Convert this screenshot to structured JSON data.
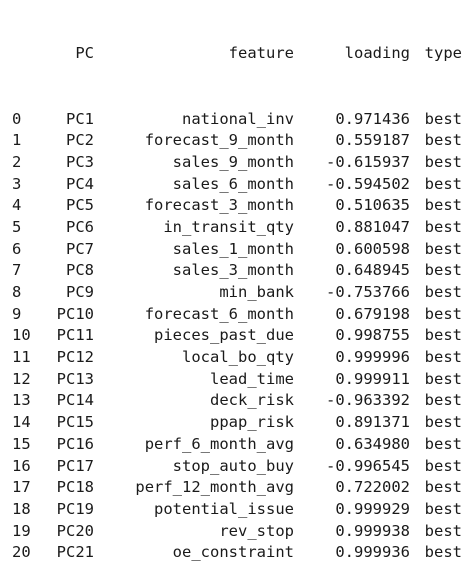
{
  "table": {
    "columns": [
      "PC",
      "feature",
      "loading",
      "type"
    ],
    "rows": [
      {
        "index": "0",
        "pc": "PC1",
        "feature": "national_inv",
        "loading": "0.971436",
        "type": "best"
      },
      {
        "index": "1",
        "pc": "PC2",
        "feature": "forecast_9_month",
        "loading": "0.559187",
        "type": "best"
      },
      {
        "index": "2",
        "pc": "PC3",
        "feature": "sales_9_month",
        "loading": "-0.615937",
        "type": "best"
      },
      {
        "index": "3",
        "pc": "PC4",
        "feature": "sales_6_month",
        "loading": "-0.594502",
        "type": "best"
      },
      {
        "index": "4",
        "pc": "PC5",
        "feature": "forecast_3_month",
        "loading": "0.510635",
        "type": "best"
      },
      {
        "index": "5",
        "pc": "PC6",
        "feature": "in_transit_qty",
        "loading": "0.881047",
        "type": "best"
      },
      {
        "index": "6",
        "pc": "PC7",
        "feature": "sales_1_month",
        "loading": "0.600598",
        "type": "best"
      },
      {
        "index": "7",
        "pc": "PC8",
        "feature": "sales_3_month",
        "loading": "0.648945",
        "type": "best"
      },
      {
        "index": "8",
        "pc": "PC9",
        "feature": "min_bank",
        "loading": "-0.753766",
        "type": "best"
      },
      {
        "index": "9",
        "pc": "PC10",
        "feature": "forecast_6_month",
        "loading": "0.679198",
        "type": "best"
      },
      {
        "index": "10",
        "pc": "PC11",
        "feature": "pieces_past_due",
        "loading": "0.998755",
        "type": "best"
      },
      {
        "index": "11",
        "pc": "PC12",
        "feature": "local_bo_qty",
        "loading": "0.999996",
        "type": "best"
      },
      {
        "index": "12",
        "pc": "PC13",
        "feature": "lead_time",
        "loading": "0.999911",
        "type": "best"
      },
      {
        "index": "13",
        "pc": "PC14",
        "feature": "deck_risk",
        "loading": "-0.963392",
        "type": "best"
      },
      {
        "index": "14",
        "pc": "PC15",
        "feature": "ppap_risk",
        "loading": "0.891371",
        "type": "best"
      },
      {
        "index": "15",
        "pc": "PC16",
        "feature": "perf_6_month_avg",
        "loading": "0.634980",
        "type": "best"
      },
      {
        "index": "16",
        "pc": "PC17",
        "feature": "stop_auto_buy",
        "loading": "-0.996545",
        "type": "best"
      },
      {
        "index": "17",
        "pc": "PC18",
        "feature": "perf_12_month_avg",
        "loading": "0.722002",
        "type": "best"
      },
      {
        "index": "18",
        "pc": "PC19",
        "feature": "potential_issue",
        "loading": "0.999929",
        "type": "best"
      },
      {
        "index": "19",
        "pc": "PC20",
        "feature": "rev_stop",
        "loading": "0.999938",
        "type": "best"
      },
      {
        "index": "20",
        "pc": "PC21",
        "feature": "oe_constraint",
        "loading": "0.999936",
        "type": "best"
      }
    ]
  }
}
